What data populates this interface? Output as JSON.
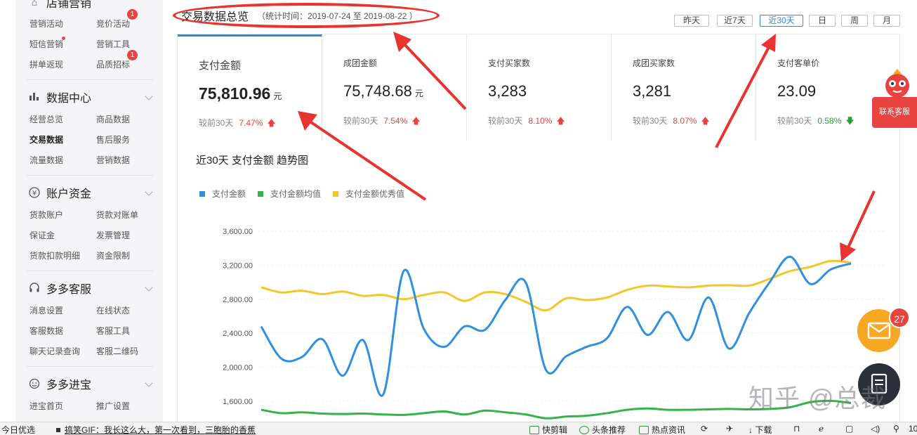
{
  "sidebar": {
    "shop_marketing": {
      "title": "店铺营销",
      "items": [
        "营销活动",
        "竞价活动",
        "短信营销",
        "营销工具",
        "拼单返现",
        "品质招标"
      ],
      "badges": [
        "1",
        "1"
      ]
    },
    "data_center": {
      "title": "数据中心",
      "items": [
        "经营总览",
        "商品数据",
        "交易数据",
        "售后服务",
        "流量数据",
        "营销数据"
      ],
      "active": "交易数据"
    },
    "account_funds": {
      "title": "账户资金",
      "items": [
        "货款账户",
        "货款对账单",
        "保证金",
        "发票管理",
        "货款扣款明细",
        "资金限制"
      ]
    },
    "customer_service": {
      "title": "多多客服",
      "items": [
        "消息设置",
        "在线状态",
        "客服数据",
        "客服工具",
        "聊天记录查询",
        "客服二维码"
      ]
    },
    "duoduo_jinbao": {
      "title": "多多进宝",
      "items": [
        "进宝首页",
        "推广设置"
      ]
    }
  },
  "header": {
    "title": "交易数据总览",
    "subtitle": "（统计时间：2019-07-24 至 2019-08-22 ）"
  },
  "range_buttons": [
    {
      "label": "昨天",
      "active": false
    },
    {
      "label": "近7天",
      "active": false
    },
    {
      "label": "近30天",
      "active": true
    },
    {
      "label": "日",
      "active": false
    },
    {
      "label": "周",
      "active": false
    },
    {
      "label": "月",
      "active": false
    }
  ],
  "kpis": [
    {
      "label": "支付金额",
      "value": "75,810.96",
      "unit": "元",
      "compare": "较前30天",
      "pct": "7.47%",
      "dir": "up",
      "active": true
    },
    {
      "label": "成团金额",
      "value": "75,748.68",
      "unit": "元",
      "compare": "较前30天",
      "pct": "7.54%",
      "dir": "up",
      "active": false
    },
    {
      "label": "支付买家数",
      "value": "3,283",
      "unit": "",
      "compare": "较前30天",
      "pct": "8.10%",
      "dir": "up",
      "active": false
    },
    {
      "label": "成团买家数",
      "value": "3,281",
      "unit": "",
      "compare": "较前30天",
      "pct": "8.07%",
      "dir": "up",
      "active": false
    },
    {
      "label": "支付客单价",
      "value": "23.09",
      "unit": "",
      "compare": "较前30天",
      "pct": "0.58%",
      "dir": "down",
      "active": false
    }
  ],
  "chart_title": "近30天 支付金额 趋势图",
  "colors": {
    "primary": "#2f8bd8",
    "series_blue": "#2f8fe0",
    "series_green": "#34b34a",
    "series_yellow": "#f3c728",
    "up": "#e8433f",
    "down": "#2e9c3d",
    "annotation_red": "#e8332e"
  },
  "chart_data": {
    "type": "line",
    "title": "近30天 支付金额 趋势图",
    "y_ticks": [
      "3,600.00",
      "3,200.00",
      "2,800.00",
      "2,400.00",
      "2,000.00",
      "1,600.00"
    ],
    "y_tick_values": [
      3600,
      3200,
      2800,
      2400,
      2000,
      1600
    ],
    "ylim": [
      1400,
      3700
    ],
    "grid": true,
    "legend_position": "top-left",
    "x": [
      1,
      2,
      3,
      4,
      5,
      6,
      7,
      8,
      9,
      10,
      11,
      12,
      13,
      14,
      15,
      16,
      17,
      18,
      19,
      20,
      21,
      22,
      23,
      24,
      25,
      26,
      27,
      28,
      29,
      30
    ],
    "series": [
      {
        "name": "支付金额",
        "color": "#2f8fe0",
        "values": [
          2480,
          2100,
          2120,
          2330,
          1900,
          2320,
          1680,
          3130,
          2450,
          2240,
          2480,
          2440,
          2790,
          3000,
          1970,
          2130,
          2240,
          2340,
          2710,
          2380,
          2650,
          2320,
          2820,
          2220,
          2640,
          3000,
          3300,
          2980,
          3150,
          3220
        ]
      },
      {
        "name": "支付金额均值",
        "color": "#34b34a",
        "values": [
          1500,
          1460,
          1470,
          1455,
          1450,
          1455,
          1445,
          1440,
          1460,
          1480,
          1445,
          1490,
          1470,
          1445,
          1400,
          1420,
          1430,
          1460,
          1500,
          1515,
          1500,
          1500,
          1505,
          1510,
          1505,
          1510,
          1530,
          1590,
          1605,
          1580
        ]
      },
      {
        "name": "支付金额优秀值",
        "color": "#f3c728",
        "values": [
          2940,
          2880,
          2900,
          2860,
          2890,
          2840,
          2850,
          2800,
          2850,
          2880,
          2780,
          2880,
          2860,
          2770,
          2670,
          2810,
          2790,
          2820,
          2910,
          2960,
          2950,
          2940,
          2960,
          2965,
          2960,
          3040,
          3130,
          3180,
          3250,
          3230
        ]
      }
    ]
  },
  "floating": {
    "customer_service_label": "联系客服",
    "mail_badge": "27",
    "watermark": "知乎 @总裁"
  },
  "taskbar": {
    "left_label": "今日优选",
    "news": "搞笑GIF：我长这么大，第一次看到，三胞胎的香蕉",
    "items": [
      "快剪辑",
      "头条推荐",
      "热点资讯",
      "下载"
    ],
    "corner": "10"
  }
}
